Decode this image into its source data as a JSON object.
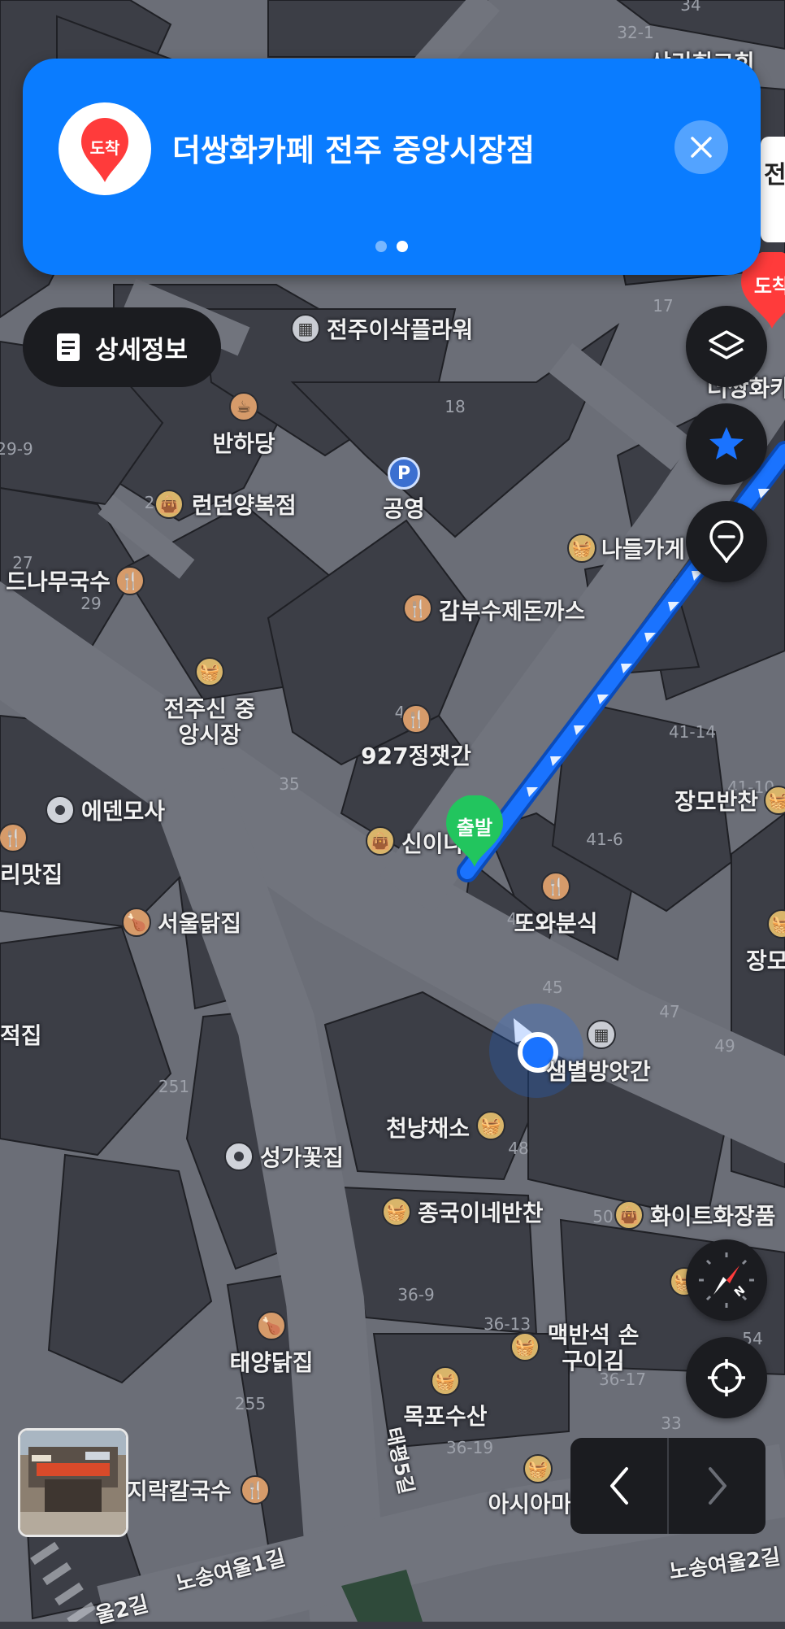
{
  "destination_card": {
    "badge_label": "도착",
    "title": "더쌍화카페 전주 중앙시장점",
    "page_count": 2,
    "active_page": 2
  },
  "detail_button": {
    "label": "상세정보"
  },
  "route": {
    "start_label": "출발",
    "end_label": "도착",
    "color": "#1a73ff",
    "start_color": "#22c55e",
    "end_color": "#ff3b3b"
  },
  "peek_text": "전",
  "map_labels": {
    "poi": [
      {
        "name": "전주이삭플라워",
        "kind": "bld"
      },
      {
        "name": "반하당",
        "kind": "food"
      },
      {
        "name": "런던양복점",
        "kind": "shop"
      },
      {
        "name": "공영",
        "kind": "park"
      },
      {
        "name": "나들가게",
        "kind": "shop"
      },
      {
        "name": "드나무국수",
        "kind": "food"
      },
      {
        "name": "갑부수제돈까스",
        "kind": "food"
      },
      {
        "name": "전주신 중앙시장",
        "kind": "shop"
      },
      {
        "name": "927정잿간",
        "kind": "food"
      },
      {
        "name": "에덴모사",
        "kind": "dot"
      },
      {
        "name": "신이나",
        "kind": "shop"
      },
      {
        "name": "리맛집",
        "kind": "food"
      },
      {
        "name": "장모반찬",
        "kind": "shop"
      },
      {
        "name": "또와분식",
        "kind": "food"
      },
      {
        "name": "서울닭집",
        "kind": "food"
      },
      {
        "name": "장모",
        "kind": "shop"
      },
      {
        "name": "샘별방앗간",
        "kind": "bld"
      },
      {
        "name": "천냥채소",
        "kind": "shop"
      },
      {
        "name": "성가꽃집",
        "kind": "dot"
      },
      {
        "name": "종국이네반찬",
        "kind": "shop"
      },
      {
        "name": "화이트화장품",
        "kind": "shop"
      },
      {
        "name": "태양닭집",
        "kind": "food"
      },
      {
        "name": "맥반석 손구이김",
        "kind": "shop"
      },
      {
        "name": "목포수산",
        "kind": "shop"
      },
      {
        "name": "지락칼국수",
        "kind": "food"
      },
      {
        "name": "아시아마",
        "kind": "shop"
      },
      {
        "name": "더쌍화카",
        "kind": "food"
      },
      {
        "name": "적집",
        "kind": "food"
      },
      {
        "name": "상리회교회",
        "kind": "bld"
      }
    ],
    "roads": [
      "태평5길",
      "노송여울1길",
      "노송여울2길",
      "울2길"
    ],
    "numbers": [
      "34",
      "32-1",
      "17",
      "18",
      "29-9",
      "27",
      "29",
      "2",
      "4",
      "35",
      "41-14",
      "41-10",
      "41-6",
      "4",
      "45",
      "47",
      "49",
      "251",
      "48",
      "50",
      "36-9",
      "36-13",
      "36-17",
      "54",
      "255",
      "36-19",
      "33",
      "2"
    ]
  }
}
